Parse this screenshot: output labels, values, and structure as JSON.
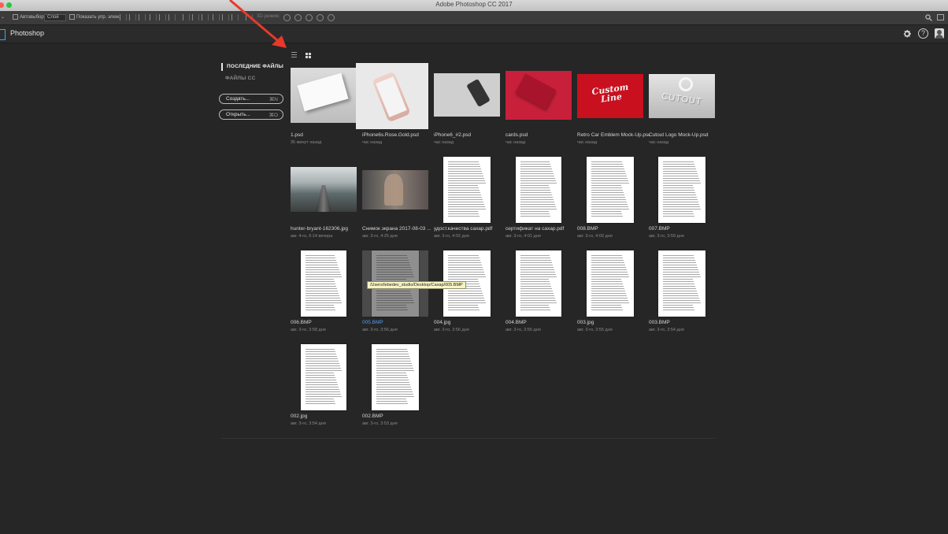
{
  "window": {
    "title": "Adobe Photoshop CC 2017",
    "traffic_light_colors": [
      "#fe5f57",
      "#febc2e",
      "#28c840"
    ]
  },
  "options_bar": {
    "auto_select_label": "Автовыбор:",
    "layer_select_value": "Слой",
    "show_controls_label": "Показать упр. элем.",
    "mode_3d_label": "3D-режим:"
  },
  "app_bar": {
    "app_name": "Photoshop",
    "brand_color": "#31a8ff",
    "icons": [
      "gear-icon",
      "help-icon",
      "avatar"
    ],
    "help_glyph": "?"
  },
  "sidebar": {
    "recent_files": "ПОСЛЕДНИЕ ФАЙЛЫ",
    "cc_files": "ФАЙЛЫ CC",
    "create_button": {
      "label": "Создать...",
      "shortcut": "⌘N"
    },
    "open_button": {
      "label": "Открыть...",
      "shortcut": "⌘O"
    }
  },
  "view_toggle": {
    "list_icon": "list-view-icon",
    "grid_icon": "grid-view-icon",
    "selected": "grid"
  },
  "files": [
    {
      "name": "1.psd",
      "date": "35 минут назад",
      "kind": "card"
    },
    {
      "name": "iPhone6s.Rose.Gold.psd",
      "date": "час назад",
      "kind": "phone-rose"
    },
    {
      "name": "iPhone6_#2.psd",
      "date": "час назад",
      "kind": "phone-desk"
    },
    {
      "name": "cards.psd",
      "date": "час назад",
      "kind": "red-cards"
    },
    {
      "name": "Retro Car Emblem Mock-Up.psd",
      "date": "час назад",
      "kind": "emblem",
      "emblem_text": "Custom Line"
    },
    {
      "name": "Cutout Logo Mock-Up.psd",
      "date": "час назад",
      "kind": "cutout",
      "cutout_text": "CUTOUT"
    },
    {
      "name": "hunter-bryant-162306.jpg",
      "date": "авг. 4-го, 6:14 вечера",
      "kind": "railway"
    },
    {
      "name": "Снимок экрана 2017-08-03 ...",
      "date": "авг. 3-го, 4:25 дня",
      "kind": "screenshot"
    },
    {
      "name": "удост.качества сахар.pdf",
      "date": "авг. 3-го, 4:02 дня",
      "kind": "doc"
    },
    {
      "name": "сертификат на сахар.pdf",
      "date": "авг. 3-го, 4:01 дня",
      "kind": "doc"
    },
    {
      "name": "008.BMP",
      "date": "авг. 3-го, 4:00 дня",
      "kind": "doc"
    },
    {
      "name": "007.BMP",
      "date": "авг. 3-го, 3:59 дня",
      "kind": "doc"
    },
    {
      "name": "006.BMP",
      "date": "авг. 3-го, 3:58 дня",
      "kind": "doc"
    },
    {
      "name": "005.BMP",
      "date": "авг. 3-го, 3:56 дня",
      "kind": "doc-hover",
      "active": true
    },
    {
      "name": "004.jpg",
      "date": "авг. 3-го, 3:56 дня",
      "kind": "doc"
    },
    {
      "name": "004.BMP",
      "date": "авг. 3-го, 3:56 дня",
      "kind": "doc"
    },
    {
      "name": "003.jpg",
      "date": "авг. 3-го, 3:55 дня",
      "kind": "doc"
    },
    {
      "name": "003.BMP",
      "date": "авг. 3-го, 3:54 дня",
      "kind": "doc"
    },
    {
      "name": "002.jpg",
      "date": "авг. 3-го, 3:54 дня",
      "kind": "doc"
    },
    {
      "name": "002.BMP",
      "date": "авг. 3-го, 3:53 дня",
      "kind": "doc"
    }
  ],
  "tooltip": {
    "text": "/Users/lebedev_studio/Desktop/Сахар/005.BMP"
  },
  "annotation": {
    "arrow_color": "#e8392b"
  }
}
